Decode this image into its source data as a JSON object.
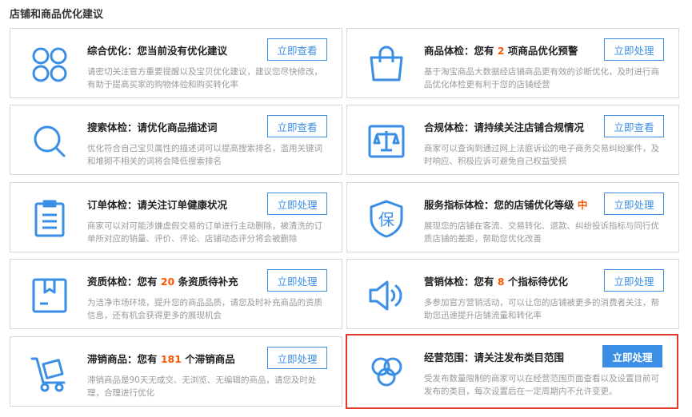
{
  "section": {
    "title": "店铺和商品优化建议"
  },
  "colors": {
    "accent": "#3a8ee6",
    "highlight_border": "#e23b2e",
    "number": "#ff5500"
  },
  "cards": [
    {
      "icon": "grid-circles-icon",
      "title_prefix": "综合优化：您当前没有优化建议",
      "num": "",
      "title_suffix": "",
      "desc": "请密切关注官方重要提醒以及宝贝优化建议，建议您尽快修改，有助于提高买家的购物体验和购买转化率",
      "button": "立即查看"
    },
    {
      "icon": "shopping-bag-icon",
      "title_prefix": "商品体检：您有 ",
      "num": "2",
      "title_suffix": " 项商品优化预警",
      "desc": "基于淘宝商品大数据经店铺商品更有效的诊断优化，及时进行商品优化体检更有利于您的店铺经营",
      "button": "立即处理"
    },
    {
      "icon": "search-icon",
      "title_prefix": "搜索体检：请优化商品描述词",
      "num": "",
      "title_suffix": "",
      "desc": "优化符合自己宝贝属性的描述词可以提高搜索排名，滥用关键词和堆砌不相关的词将会降低搜索排名",
      "button": "立即查看"
    },
    {
      "icon": "scale-icon",
      "title_prefix": "合规体检：请持续关注店铺合规情况",
      "num": "",
      "title_suffix": "",
      "desc": "商家可以查询到通过网上法庭诉讼的电子商务交易纠纷案件，及时响应、积极应诉可避免自己权益受损",
      "button": "立即查看"
    },
    {
      "icon": "clipboard-icon",
      "title_prefix": "订单体检：请关注订单健康状况",
      "num": "",
      "title_suffix": "",
      "desc": "商家可以对可能涉嫌虚假交易的订单进行主动删除，被清洗的订单所对应的销量、评价、评论、店铺动态评分将会被删除",
      "button": "立即处理"
    },
    {
      "icon": "shield-bao-icon",
      "title_prefix": "服务指标体检：您的店铺优化等级 ",
      "num": "中",
      "title_suffix": "",
      "desc": "展现您的店铺在客流、交易转化、退款、纠纷投诉指标与同行优质店铺的差距，帮助您优化改善",
      "button": "立即处理"
    },
    {
      "icon": "package-icon",
      "title_prefix": "资质体检：您有 ",
      "num": "20",
      "title_suffix": " 条资质待补充",
      "desc": "为洁净市场环境，提升您的商品品质，请您及时补充商品的资质信息，还有机会获得更多的展现机会",
      "button": "立即处理"
    },
    {
      "icon": "speaker-icon",
      "title_prefix": "营销体检：您有 ",
      "num": "8",
      "title_suffix": " 个指标待优化",
      "desc": "多参加官方营销活动，可以让您的店铺被更多的消费者关注，帮助您迅速提升店铺流量和转化率",
      "button": "立即处理"
    },
    {
      "icon": "hand-truck-icon",
      "title_prefix": "滞销商品：您有 ",
      "num": "181",
      "title_suffix": " 个滞销商品",
      "desc": "滞销商品是90天无成交、无浏览、无编辑的商品，请您及时处理，合理进行优化",
      "button": "立即处理"
    },
    {
      "icon": "circles-overlap-icon",
      "title_prefix": "经营范围：请关注发布类目范围",
      "num": "",
      "title_suffix": "",
      "desc": "受发布数量限制的商家可以在经营范围页面查看以及设置目前可发布的类目，每次设置后在一定周期内不允许变更。",
      "button": "立即处理"
    }
  ]
}
